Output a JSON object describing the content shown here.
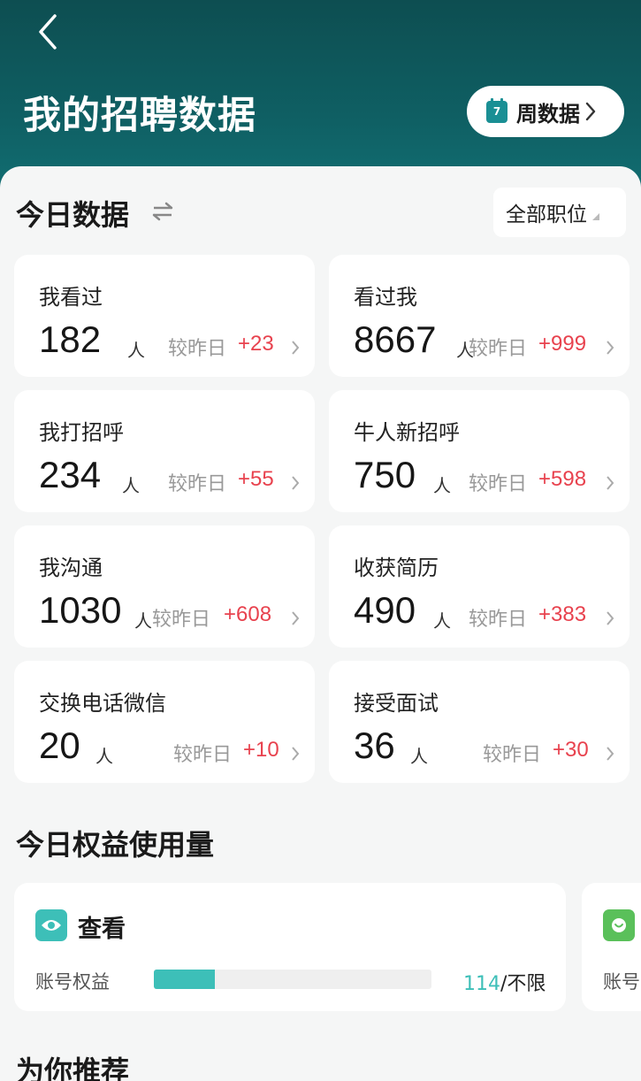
{
  "header": {
    "title": "我的招聘数据",
    "week_button": "周数据",
    "calendar_day": "7"
  },
  "today": {
    "title": "今日数据",
    "filter": "全部职位",
    "compare_label": "较昨日",
    "unit": "人",
    "cards": [
      {
        "label": "我看过",
        "value": "182",
        "delta": "+23"
      },
      {
        "label": "看过我",
        "value": "8667",
        "delta": "+999"
      },
      {
        "label": "我打招呼",
        "value": "234",
        "delta": "+55"
      },
      {
        "label": "牛人新招呼",
        "value": "750",
        "delta": "+598"
      },
      {
        "label": "我沟通",
        "value": "1030",
        "delta": "+608"
      },
      {
        "label": "收获简历",
        "value": "490",
        "delta": "+383"
      },
      {
        "label": "交换电话微信",
        "value": "20",
        "delta": "+10"
      },
      {
        "label": "接受面试",
        "value": "36",
        "delta": "+30"
      }
    ]
  },
  "quota": {
    "title": "今日权益使用量",
    "items": [
      {
        "title": "查看",
        "label": "账号权益",
        "used": "114",
        "limit": "/不限",
        "progress_fraction": 0.22
      },
      {
        "label": "账号"
      }
    ]
  },
  "recommend": {
    "title": "为你推荐"
  },
  "colors": {
    "header_bg": "#0f5e62",
    "accent": "#3dbfb8",
    "delta_red": "#e8424e"
  }
}
